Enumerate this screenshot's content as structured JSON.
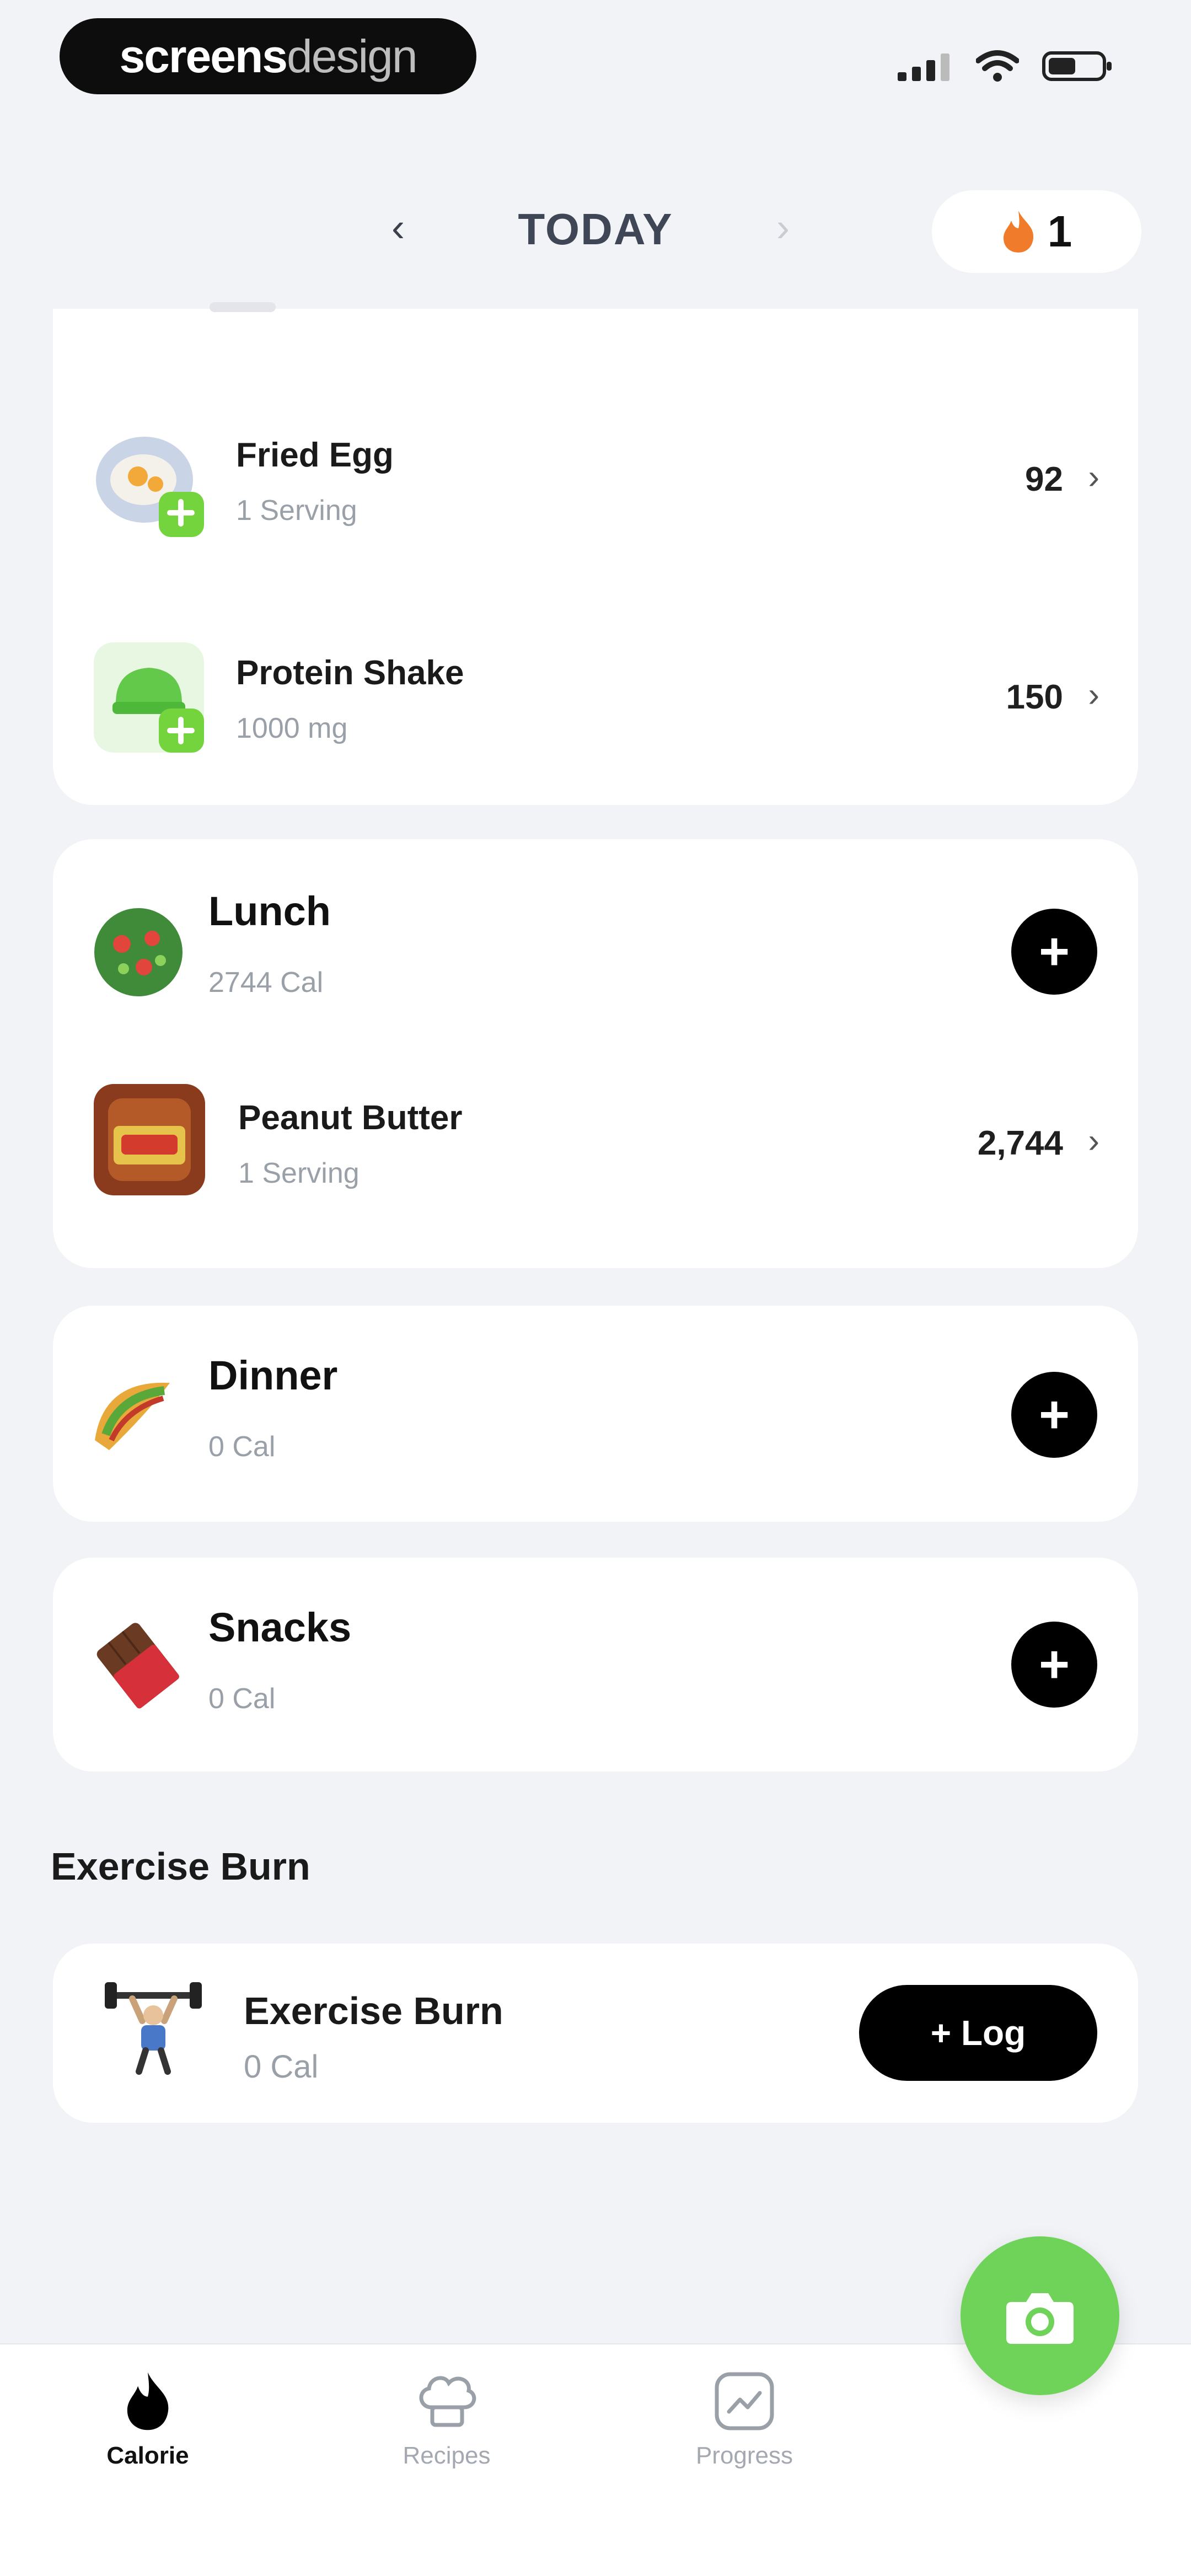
{
  "status_bar": {
    "brand_part1": "screens",
    "brand_part2": "design"
  },
  "header": {
    "date_label": "TODAY",
    "streak_count": "1"
  },
  "breakfast": {
    "items": [
      {
        "name": "Fried Egg",
        "portion": "1 Serving",
        "calories": "92"
      },
      {
        "name": "Protein Shake",
        "portion": "1000 mg",
        "calories": "150"
      }
    ]
  },
  "lunch": {
    "title": "Lunch",
    "calories": "2744 Cal",
    "items": [
      {
        "name": "Peanut Butter",
        "portion": "1 Serving",
        "calories": "2,744"
      }
    ]
  },
  "dinner": {
    "title": "Dinner",
    "calories": "0 Cal"
  },
  "snacks": {
    "title": "Snacks",
    "calories": "0 Cal"
  },
  "exercise": {
    "section_title": "Exercise Burn",
    "title": "Exercise Burn",
    "calories": "0 Cal",
    "log_button": "+ Log"
  },
  "bottom_nav": {
    "items": [
      {
        "label": "Calorie",
        "icon": "flame-icon",
        "active": true
      },
      {
        "label": "Recipes",
        "icon": "chef-hat-icon",
        "active": false
      },
      {
        "label": "Progress",
        "icon": "chart-icon",
        "active": false
      }
    ]
  },
  "colors": {
    "accent_green": "#6fd35a",
    "flame_orange": "#f07b2a",
    "background": "#f1f3f7"
  }
}
